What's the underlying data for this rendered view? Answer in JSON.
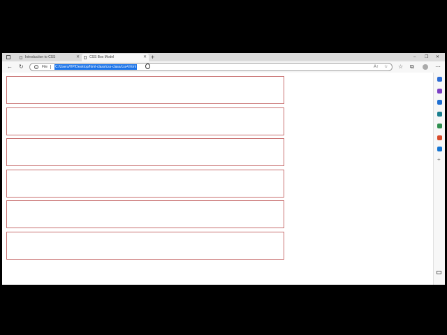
{
  "browser": {
    "tabs": [
      {
        "title": "Introduction to CSS",
        "active": false
      },
      {
        "title": "CSS Box Model",
        "active": true
      }
    ],
    "new_tab_label": "+",
    "window_controls": [
      "–",
      "❐",
      "✕"
    ],
    "close_glyph": "✕",
    "nav": {
      "back": "←",
      "reload": "↻"
    },
    "address": {
      "scheme_label": "File",
      "url": "C:/Users/HP/Desktop/html-class/css-class/css4.html"
    },
    "addr_icons": {
      "read_aloud": "A↑",
      "favorite": "☆"
    },
    "toolbar_icons": {
      "favorites": "☆",
      "collections": "⧉",
      "more": "⋯"
    }
  },
  "page": {
    "box_count": 6,
    "border_color": "#c87070"
  },
  "sidebar_colors": [
    "#2b6cd4",
    "#7b3fc4",
    "#1f6fd1",
    "#1b7f8f",
    "#2f8f4f",
    "#d84a2a",
    "#1474d2"
  ]
}
